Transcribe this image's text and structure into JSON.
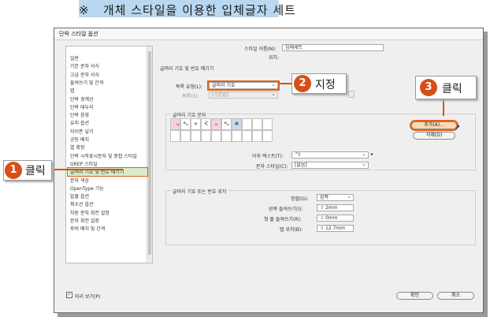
{
  "banner": {
    "text": "※   개체 스타일을 이용한 입체글자 세트"
  },
  "dialog": {
    "title": "단락 스타일 옵션",
    "sidebar": [
      "일반",
      "기본 문자 서식",
      "고급 문자 서식",
      "들여쓰기 및 간격",
      "탭",
      "단락 경계선",
      "단락 테두리",
      "단락 음영",
      "유지 옵션",
      "하이픈 넣기",
      "균등 배치",
      "열 확장",
      "단락 시작표시문자 및 중첩 스타일",
      "GREP 스타일",
      "글머리 기호 및 번호 매기기",
      "문자 색상",
      "OpenType 기능",
      "밑줄 옵션",
      "취소선 옵션",
      "자동 문자 회전 설정",
      "문자 회전 설정",
      "루비 배치 및 간격"
    ],
    "selected_index": 14,
    "style_name_label": "스타일 이름(N):",
    "style_name_value": "입체세트",
    "location_label": "위치:",
    "section_title": "글머리 기호 및 번호 매기기",
    "list_type_label": "목록 유형(L):",
    "list_type_value": "글머리 기호",
    "list_label": "목록(S):",
    "list_value": "[기본값]",
    "bullet_char_title": "글머리 기호 문자",
    "glyphs": [
      "ᆞᵤ",
      "*ᵤ",
      "»",
      "ᢵ",
      "ᵤ",
      "*ᵤ",
      "※",
      "",
      "",
      "",
      "",
      "",
      "",
      "",
      "",
      "",
      "",
      "",
      "",
      ""
    ],
    "add_button": "추가(A)...",
    "delete_button": "삭제(D)",
    "after_text_label": "이후 텍스트(T):",
    "after_text_value": "^t",
    "char_style_label": "문자 스타일(C):",
    "char_style_value": "[없음]",
    "position_title": "글머리 기호 또는 번호 위치",
    "align_label": "정렬(G):",
    "align_value": "왼쪽",
    "left_indent_label": "왼쪽 들여쓰기(I):",
    "left_indent_value": "2mm",
    "first_line_label": "첫 줄 들여쓰기(R):",
    "first_line_value": "0mm",
    "tab_pos_label": "탭 위치(B):",
    "tab_pos_value": "12.7mm",
    "preview_label": "미리 보기(P)",
    "ok_button": "확인",
    "cancel_button": "취소"
  },
  "callouts": {
    "c1": {
      "num": "1",
      "text": "클릭"
    },
    "c2": {
      "num": "2",
      "text": "지정"
    },
    "c3": {
      "num": "3",
      "text": "클릭"
    }
  },
  "accent_color": "#d64f19",
  "highlight_color": "#e2601a"
}
